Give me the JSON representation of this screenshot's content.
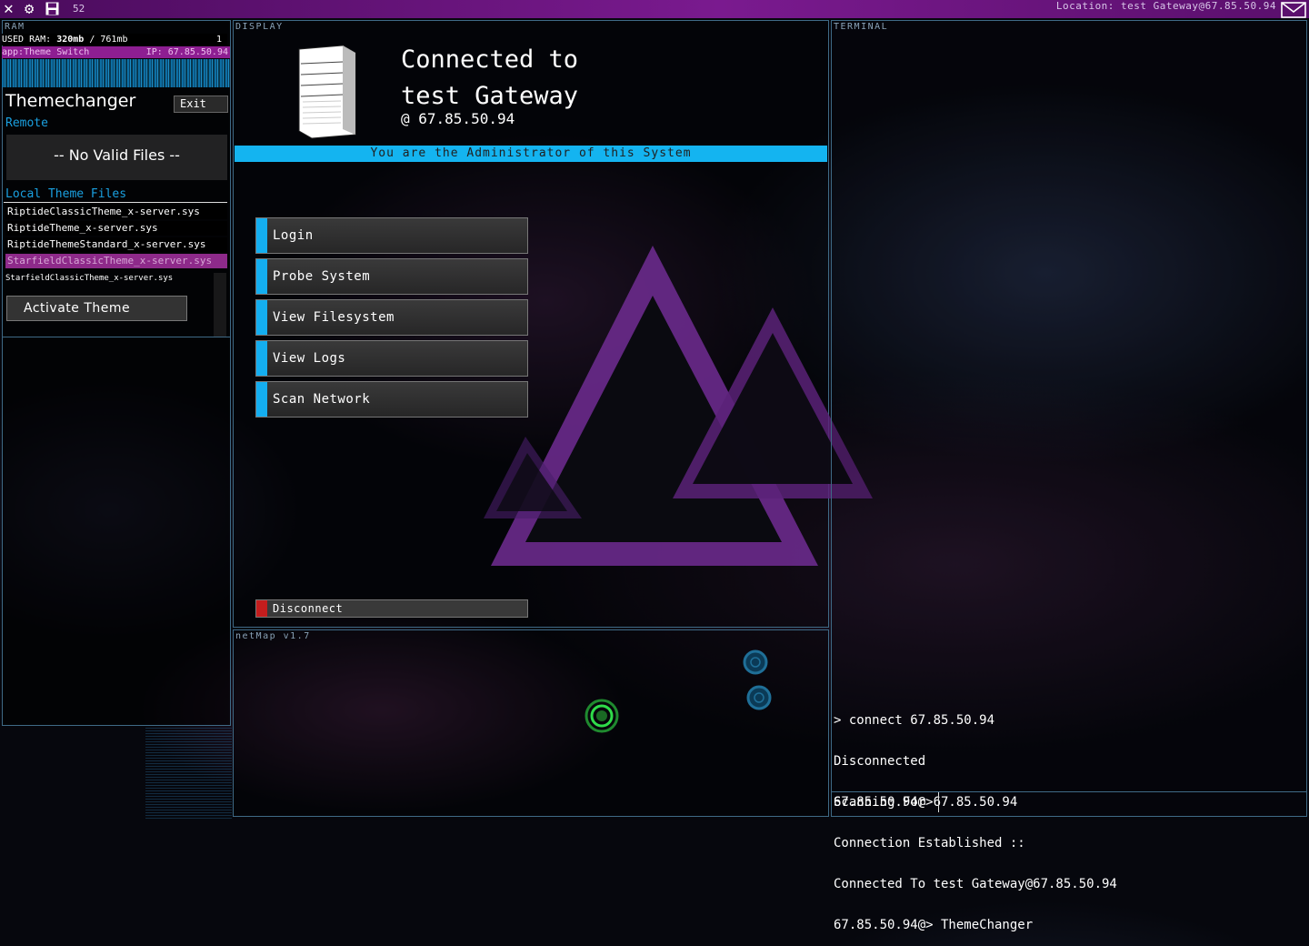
{
  "topbar": {
    "fps": "52",
    "location": "Location: test Gateway@67.85.50.94"
  },
  "ram": {
    "label": "RAM",
    "used_prefix": "USED RAM: ",
    "used_value": "320mb",
    "total": " / 761mb",
    "count": "1"
  },
  "app": {
    "bar_name": "app:Theme Switch",
    "bar_ip": "IP: 67.85.50.94",
    "title": "Themechanger",
    "exit_label": "Exit",
    "remote_label": "Remote",
    "no_files": "-- No Valid Files --",
    "local_label": "Local Theme Files",
    "files": [
      "RiptideClassicTheme_x-server.sys",
      "RiptideTheme_x-server.sys",
      "RiptideThemeStandard_x-server.sys",
      "StarfieldClassicTheme_x-server.sys"
    ],
    "selected_index": 3,
    "selected_file": "StarfieldClassicTheme_x-server.sys",
    "activate_label": "Activate Theme"
  },
  "display": {
    "label": "DISPLAY",
    "connected_line1": "Connected to",
    "connected_line2": "test Gateway",
    "connected_ip": "@  67.85.50.94",
    "admin_notice": "You are the Administrator of this System",
    "menu": [
      "Login",
      "Probe System",
      "View Filesystem",
      "View Logs",
      "Scan Network"
    ],
    "disconnect_label": "Disconnect",
    "accent_color": "#14b4f0",
    "disconnect_color": "#c41d1d"
  },
  "netmap": {
    "label": "netMap v1.7"
  },
  "terminal": {
    "label": "TERMINAL",
    "lines": [
      "> connect 67.85.50.94",
      "Disconnected",
      "Scanning For 67.85.50.94",
      "Connection Established ::",
      "Connected To test Gateway@67.85.50.94",
      "67.85.50.94@> ThemeChanger"
    ],
    "prompt": "67.85.50.94@>"
  }
}
